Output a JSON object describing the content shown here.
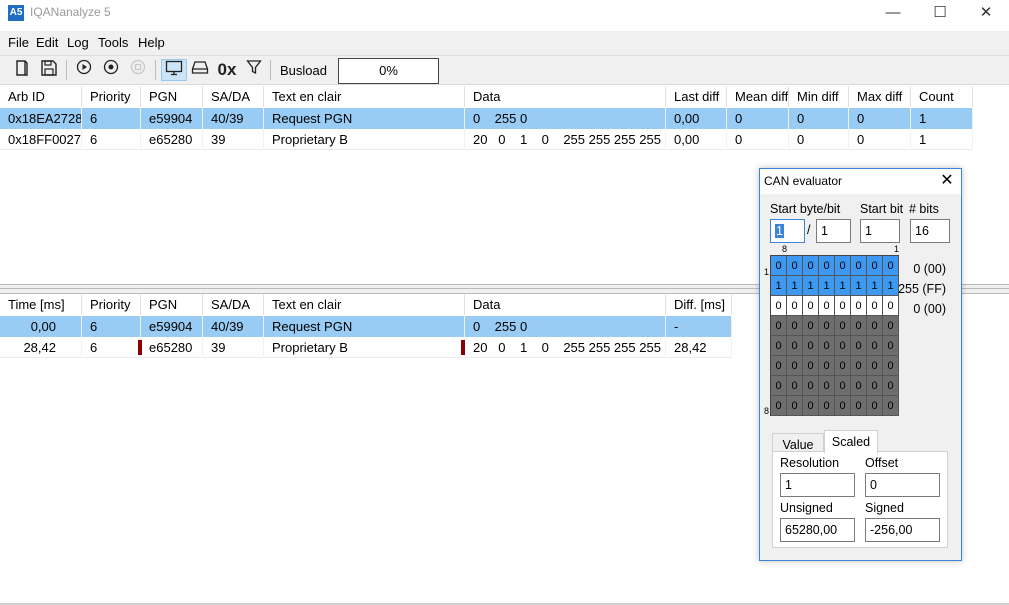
{
  "window": {
    "app_icon": "A5",
    "title": "IQANanalyze 5",
    "minimize": "—",
    "maximize": "☐",
    "close": "✕"
  },
  "menu": [
    "File",
    "Edit",
    "Log",
    "Tools",
    "Help"
  ],
  "toolbar": {
    "icons": [
      "book-icon",
      "save-log-icon",
      "play-icon",
      "record-icon",
      "stop-icon",
      "monitor-icon",
      "drive-icon",
      "hex-icon",
      "filter-icon"
    ],
    "hex_label": "0x",
    "busload_label": "Busload",
    "busload_value": "0%"
  },
  "top_table": {
    "columns": [
      "Arb ID",
      "Priority",
      "PGN",
      "SA/DA",
      "Text en clair",
      "Data",
      "Last diff",
      "Mean diff",
      "Min diff",
      "Max diff",
      "Count"
    ],
    "rows": [
      [
        "0x18EA2728",
        "6",
        "e59904",
        "40/39",
        "Request PGN",
        "0    255 0",
        "0,00",
        "0",
        "0",
        "0",
        "1"
      ],
      [
        "0x18FF0027",
        "6",
        "e65280",
        "39",
        "Proprietary B",
        "20   0    1    0    255 255 255 255",
        "0,00",
        "0",
        "0",
        "0",
        "1"
      ]
    ]
  },
  "bottom_table": {
    "columns": [
      "Time [ms]",
      "Priority",
      "PGN",
      "SA/DA",
      "Text en clair",
      "Data",
      "Diff. [ms]"
    ],
    "rows": [
      [
        "0,00",
        "6",
        "e59904",
        "40/39",
        "Request PGN",
        "0    255 0",
        "-"
      ],
      [
        "28,42",
        "6",
        "e65280",
        "39",
        "Proprietary B",
        "20   0    1    0    255 255 255 255",
        "28,42"
      ]
    ]
  },
  "can_evaluator": {
    "title": "CAN evaluator",
    "close": "✕",
    "start_byte_bit_label": "Start byte/bit",
    "start_bit_label": "Start bit",
    "num_bits_label": "# bits",
    "start_byte": "1",
    "slash": "/",
    "start_bit_in_byte": "1",
    "start_bit": "1",
    "num_bits": "16",
    "bit_col_high": "8",
    "bit_col_low": "1",
    "byte_row_first": "1",
    "byte_row_last": "8",
    "bit_rows": [
      "00000000",
      "11111111",
      "00000000",
      "00000000",
      "00000000",
      "00000000",
      "00000000",
      "00000000"
    ],
    "byte_values": [
      "0 (00)",
      "255 (FF)",
      "0 (00)"
    ],
    "tabs": [
      "Value",
      "Scaled"
    ],
    "resolution_label": "Resolution",
    "resolution": "1",
    "offset_label": "Offset",
    "offset": "0",
    "unsigned_label": "Unsigned",
    "unsigned": "65280,00",
    "signed_label": "Signed",
    "signed": "-256,00"
  }
}
